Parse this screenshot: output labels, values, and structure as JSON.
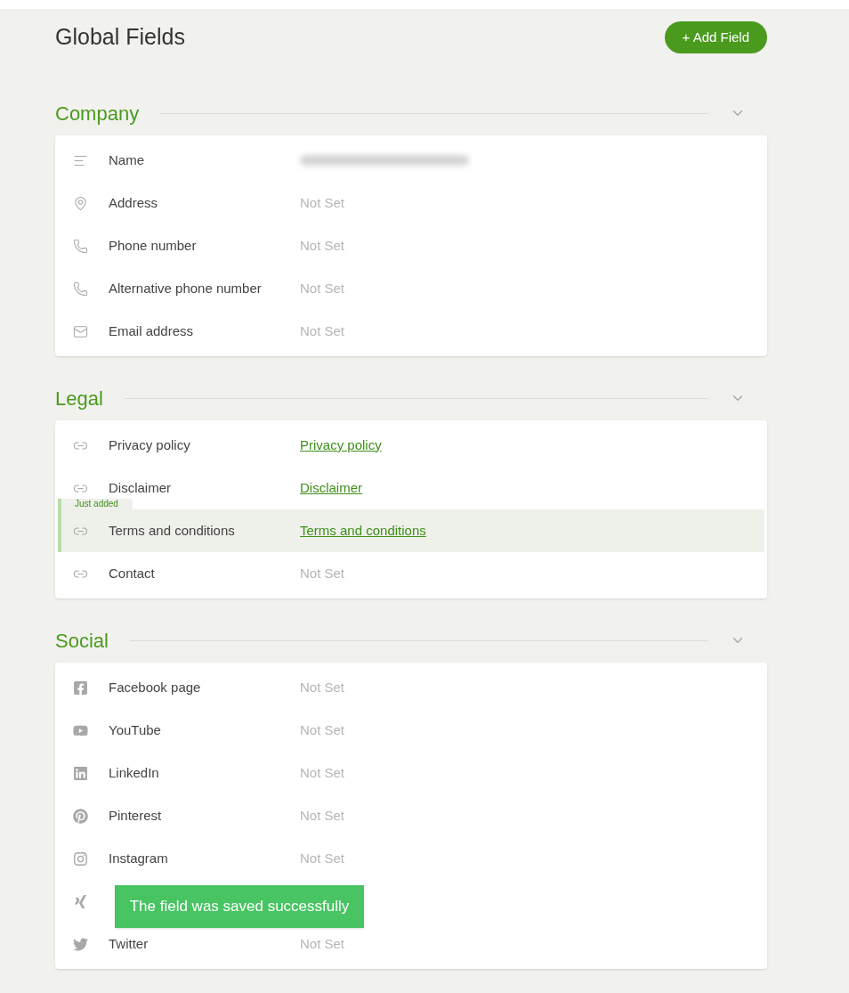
{
  "page": {
    "title": "Global Fields",
    "add_button": "+ Add Field"
  },
  "sections": [
    {
      "title": "Company",
      "expanded": true,
      "fields": [
        {
          "kind": "text",
          "label": "Name",
          "redacted": true
        },
        {
          "kind": "address",
          "label": "Address",
          "value": "Not Set",
          "set": false
        },
        {
          "kind": "phone",
          "label": "Phone number",
          "value": "Not Set",
          "set": false
        },
        {
          "kind": "phone",
          "label": "Alternative phone number",
          "value": "Not Set",
          "set": false
        },
        {
          "kind": "email",
          "label": "Email address",
          "value": "Not Set",
          "set": false
        }
      ]
    },
    {
      "title": "Legal",
      "expanded": true,
      "fields": [
        {
          "kind": "link",
          "label": "Privacy policy",
          "value": "Privacy policy",
          "set": true
        },
        {
          "kind": "link",
          "label": "Disclaimer",
          "value": "Disclaimer",
          "set": true
        },
        {
          "kind": "link",
          "label": "Terms and conditions",
          "value": "Terms and conditions",
          "set": true,
          "just_added": true,
          "badge": "Just added"
        },
        {
          "kind": "link",
          "label": "Contact",
          "value": "Not Set",
          "set": false
        }
      ]
    },
    {
      "title": "Social",
      "expanded": true,
      "fields": [
        {
          "kind": "facebook",
          "label": "Facebook page",
          "value": "Not Set",
          "set": false
        },
        {
          "kind": "youtube",
          "label": "YouTube",
          "value": "Not Set",
          "set": false
        },
        {
          "kind": "linkedin",
          "label": "LinkedIn",
          "value": "Not Set",
          "set": false
        },
        {
          "kind": "pinterest",
          "label": "Pinterest",
          "value": "Not Set",
          "set": false
        },
        {
          "kind": "instagram",
          "label": "Instagram",
          "value": "Not Set",
          "set": false
        },
        {
          "kind": "xing"
        },
        {
          "kind": "twitter",
          "label": "Twitter",
          "value": "Not Set",
          "set": false
        }
      ]
    }
  ],
  "toast": "The field was saved successfully"
}
